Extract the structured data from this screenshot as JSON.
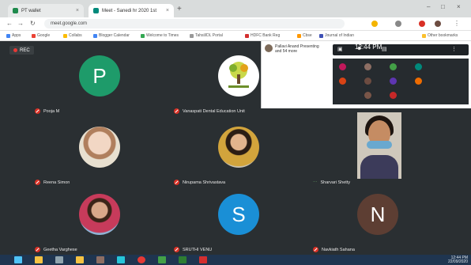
{
  "browser": {
    "tabs": [
      {
        "label": "PT wallet"
      },
      {
        "label": "Meet - Sanedi hr 2020 1st"
      }
    ],
    "url": "meet.google.com",
    "bookmarks": [
      "Apps",
      "Google",
      "Collabs",
      "Blogger Calendar",
      "Welcome to Times",
      "Tahsil/DL Portal",
      "HDFC Bank Reg",
      "Cbse",
      "Journal of Indian",
      "Other bookmarks"
    ]
  },
  "meet": {
    "rec_label": "REC",
    "presenter": {
      "line1": "Pallavi Anand Presenting",
      "line2": "and 54 more"
    },
    "clock": "12:44 PM",
    "participants": [
      {
        "name": "Pooja M",
        "initial": "P",
        "color": "#1e9b6a",
        "kind": "initial"
      },
      {
        "name": "Vanaspati Dental Education Unit",
        "initial": "",
        "color": "#ffffff",
        "kind": "logo"
      },
      {
        "name": "Sharvari Shetty",
        "initial": "",
        "color": "",
        "kind": "selfview"
      },
      {
        "name": "Reena Simon",
        "initial": "",
        "color": "",
        "kind": "photo1"
      },
      {
        "name": "Nirupama Shrivastava",
        "initial": "",
        "color": "",
        "kind": "photo2"
      },
      {
        "name": "Geetha Varghese",
        "initial": "",
        "color": "",
        "kind": "photo3"
      },
      {
        "name": "SRUTHI VENU",
        "initial": "S",
        "color": "#1a8fd6",
        "kind": "initial"
      },
      {
        "name": "Navkiath Sahana",
        "initial": "N",
        "color": "#5d3e33",
        "kind": "initial"
      }
    ]
  },
  "taskbar": {
    "time": "12:44 PM",
    "date": "22/09/2020"
  },
  "colors": {
    "meet_bg": "#2a2f32",
    "mic_off": "#d93025",
    "taskbar": "#1f3550"
  }
}
